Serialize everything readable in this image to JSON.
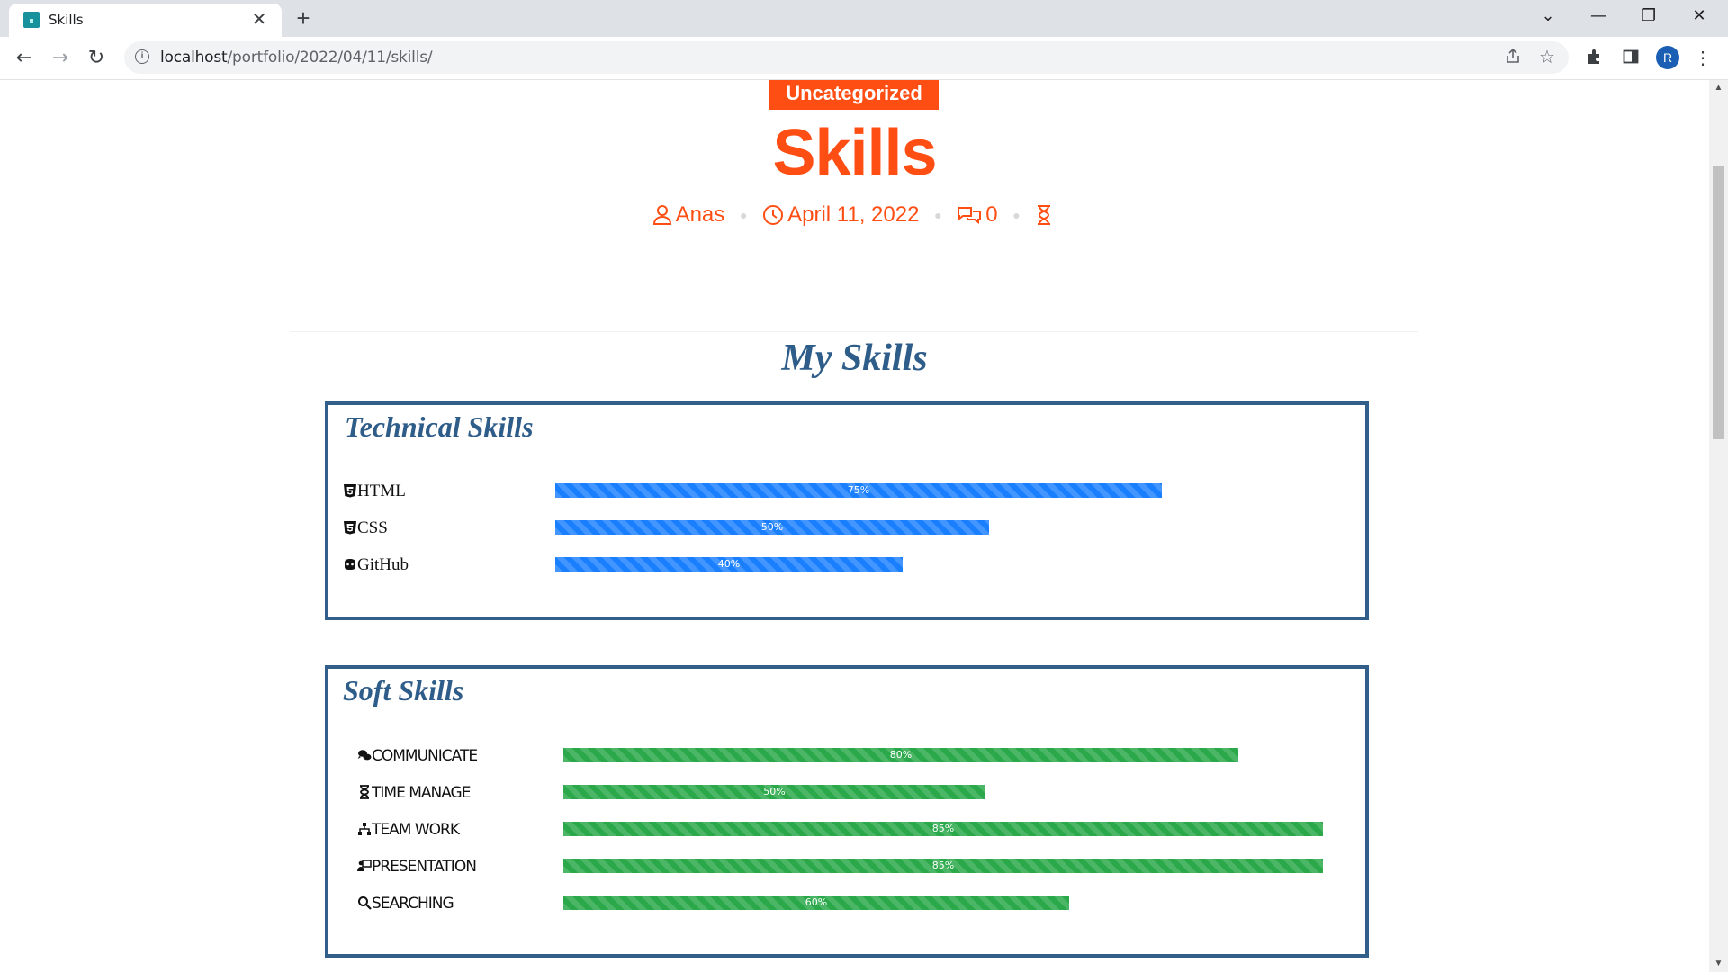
{
  "browser": {
    "tab_title": "Skills",
    "tab_close": "✕",
    "new_tab": "+",
    "url_host": "localhost",
    "url_path": "/portfolio/2022/04/11/skills/",
    "profile_initial": "R",
    "window_controls": {
      "dropdown": "⌄",
      "minimize": "—",
      "restore": "❐",
      "close": "✕"
    },
    "nav": {
      "back": "←",
      "forward": "→",
      "reload": "↻"
    }
  },
  "post": {
    "category": "Uncategorized",
    "title": "Skills",
    "author": "Anas",
    "date": "April 11, 2022",
    "comments": "0",
    "accent_color": "#ff4e14"
  },
  "section": {
    "title": "My Skills",
    "color": "#2f5d89"
  },
  "technical": {
    "title": "Technical Skills",
    "bar_color": "#1a7fff",
    "skills": [
      {
        "icon": "html5-icon",
        "name": "HTML",
        "percent_label": "75%",
        "value": 75
      },
      {
        "icon": "css3-icon",
        "name": "CSS",
        "percent_label": "50%",
        "value": 50
      },
      {
        "icon": "github-icon",
        "name": "GitHub",
        "percent_label": "40%",
        "value": 40
      }
    ]
  },
  "soft": {
    "title": "Soft Skills",
    "bar_color": "#2aa84a",
    "skills": [
      {
        "icon": "comments-icon",
        "name": "Communicate",
        "percent_label": "80%",
        "value": 80
      },
      {
        "icon": "hourglass-icon",
        "name": "Time Manage",
        "percent_label": "50%",
        "value": 50
      },
      {
        "icon": "sitemap-icon",
        "name": "Team Work",
        "percent_label": "85%",
        "value": 85
      },
      {
        "icon": "presentation-icon",
        "name": "Presentation",
        "percent_label": "85%",
        "value": 85
      },
      {
        "icon": "search-icon",
        "name": "Searching",
        "percent_label": "60%",
        "value": 60
      }
    ]
  }
}
